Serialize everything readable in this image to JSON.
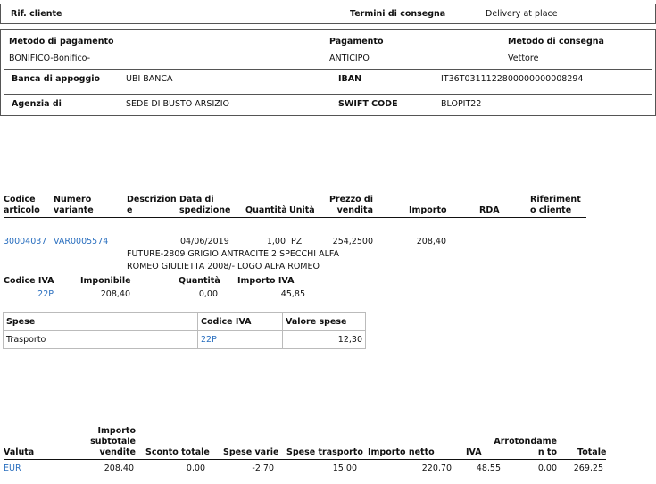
{
  "header": {
    "rif_cliente_label": "Rif. cliente",
    "termini_label": "Termini di consegna",
    "termini_value": "Delivery at place"
  },
  "payment": {
    "metodo_pagamento_label": "Metodo di pagamento",
    "pagamento_label": "Pagamento",
    "metodo_consegna_label": "Metodo di consegna",
    "metodo_pagamento_value": "BONIFICO-Bonifico-",
    "pagamento_value": "ANTICIPO",
    "metodo_consegna_value": "Vettore",
    "banca_label": "Banca di appoggio",
    "banca_value": "UBI BANCA",
    "iban_label": "IBAN",
    "iban_value": "IT36T0311122800000000008294",
    "agenzia_label": "Agenzia di",
    "agenzia_value": "SEDE DI BUSTO ARSIZIO",
    "swift_label": "SWIFT CODE",
    "swift_value": "BLOPIT22"
  },
  "lines": {
    "headers": {
      "codice": "Codice articolo",
      "numero": "Numero variante",
      "descrizione": "Descrizion e",
      "data": "Data di spedizione",
      "quantita": "Quantità",
      "unita": "Unità",
      "prezzo": "Prezzo di vendita",
      "importo": "Importo",
      "rda": "RDA",
      "riferimenti": "Riferiment o cliente"
    },
    "row": {
      "codice": "30004037",
      "numero": "VAR0005574",
      "data": "04/06/2019",
      "quantita": "1,00",
      "unita": "PZ",
      "prezzo": "254,2500",
      "importo": "208,40",
      "descrizione": "FUTURE-2809 GRIGIO ANTRACITE 2 SPECCHI ALFA ROMEO GIULIETTA 2008/- LOGO ALFA ROMEO"
    }
  },
  "iva": {
    "headers": {
      "codice": "Codice IVA",
      "imponibile": "Imponibile",
      "quantita": "Quantità",
      "importo": "Importo IVA"
    },
    "row": {
      "codice": "22P",
      "imponibile": "208,40",
      "quantita": "0,00",
      "importo": "45,85"
    }
  },
  "spese": {
    "headers": {
      "spese": "Spese",
      "codice": "Codice IVA",
      "valore": "Valore spese"
    },
    "row": {
      "spese": "Trasporto",
      "codice": "22P",
      "valore": "12,30"
    }
  },
  "totals": {
    "headers": {
      "valuta": "Valuta",
      "subtotale": "Importo subtotale vendite",
      "sconto": "Sconto totale",
      "varie": "Spese varie",
      "trasporto": "Spese trasporto",
      "netto": "Importo netto",
      "iva": "IVA",
      "arrotondamento": "Arrotondamen to",
      "totale": "Totale"
    },
    "row": {
      "valuta": "EUR",
      "subtotale": "208,40",
      "sconto": "0,00",
      "varie": "-2,70",
      "trasporto": "15,00",
      "netto": "220,70",
      "iva": "48,55",
      "arrotondamento": "0,00",
      "totale": "269,25"
    }
  }
}
